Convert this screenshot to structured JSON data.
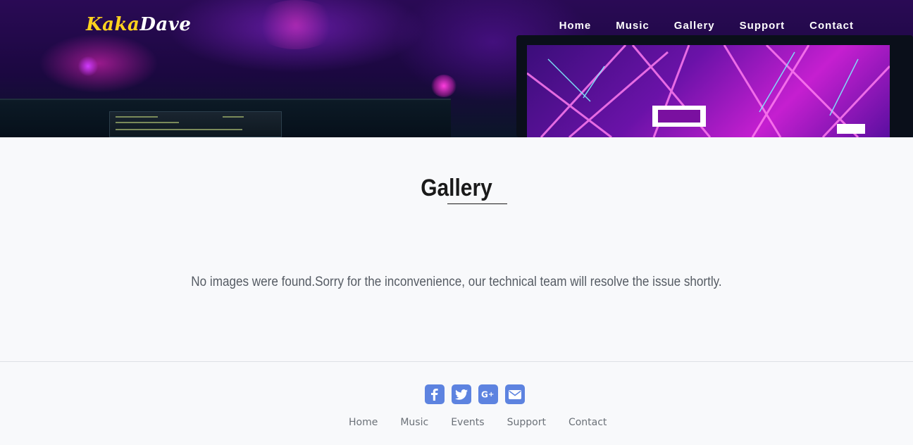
{
  "brand": {
    "part1": "Kaka",
    "part2": "Dave"
  },
  "nav": {
    "items": [
      "Home",
      "Music",
      "Gallery",
      "Support",
      "Contact"
    ]
  },
  "main": {
    "title": "Gallery",
    "empty_message": "No images were found.Sorry for the inconvenience, our technical team will resolve the issue shortly."
  },
  "footer": {
    "social": [
      "facebook-icon",
      "twitter-icon",
      "google-plus-icon",
      "envelope-icon"
    ],
    "links": [
      "Home",
      "Music",
      "Events",
      "Support",
      "Contact"
    ]
  },
  "colors": {
    "accent": "#ffd21e",
    "social": "#5d83e0",
    "text": "#555b63"
  }
}
